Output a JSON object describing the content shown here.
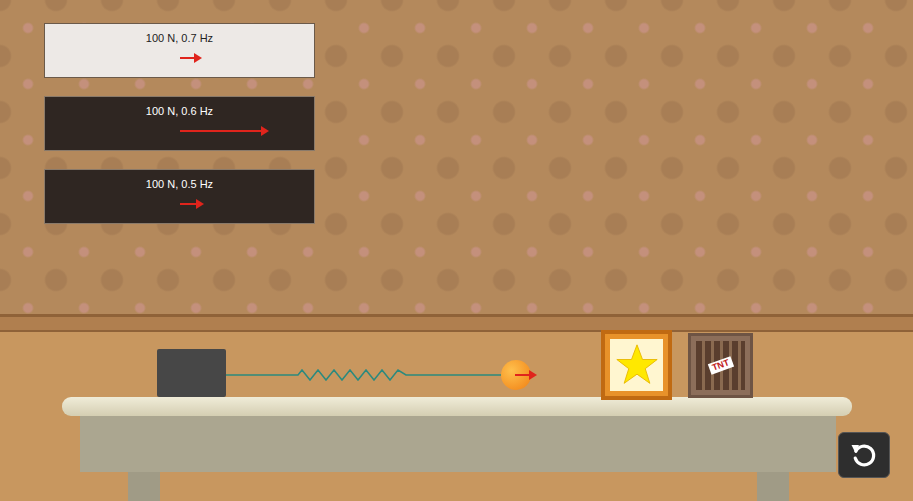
{
  "force_cards": [
    {
      "label": "100 N, 0.7 Hz",
      "selected": true,
      "arrow_level": 0.08
    },
    {
      "label": "100 N, 0.6 Hz",
      "selected": false,
      "arrow_level": 0.33
    },
    {
      "label": "100 N, 0.5 Hz",
      "selected": false,
      "arrow_level": 0.09
    }
  ],
  "scene": {
    "crates": [
      {
        "kind": "star"
      },
      {
        "kind": "tnt",
        "label": "TNT"
      }
    ]
  }
}
